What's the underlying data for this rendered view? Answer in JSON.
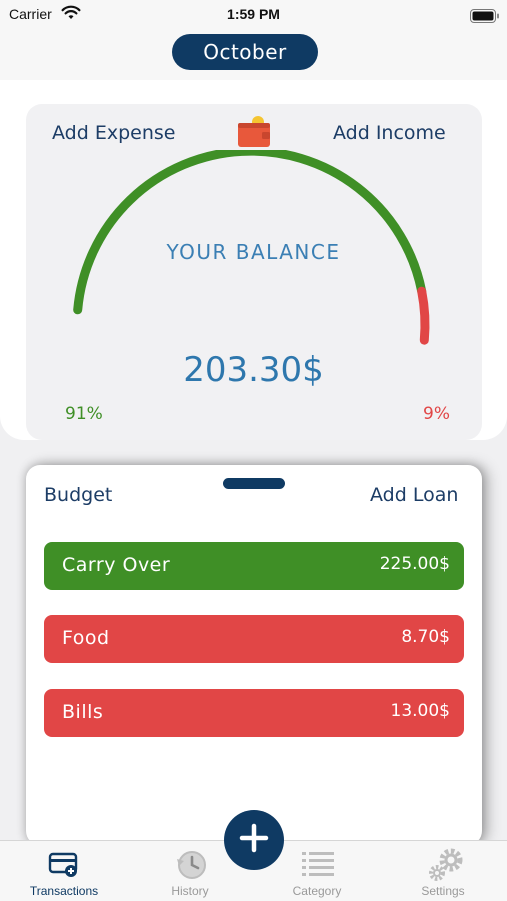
{
  "status_bar": {
    "carrier": "Carrier",
    "time": "1:59 PM"
  },
  "header": {
    "month": "October"
  },
  "balance": {
    "add_expense": "Add Expense",
    "add_income": "Add Income",
    "label": "YOUR BALANCE",
    "amount": "203.30$",
    "income_percent": "91%",
    "expense_percent": "9%",
    "income_fraction": 0.91,
    "expense_fraction": 0.09,
    "income_color": "#3f8f26",
    "expense_color": "#e14646"
  },
  "sheet": {
    "budget": "Budget",
    "add_loan": "Add Loan",
    "rows": [
      {
        "name": "Carry Over",
        "amount": "225.00$",
        "type": "income"
      },
      {
        "name": "Food",
        "amount": "8.70$",
        "type": "expense"
      },
      {
        "name": "Bills",
        "amount": "13.00$",
        "type": "expense"
      }
    ]
  },
  "tabs": [
    {
      "label": "Transactions",
      "active": true,
      "icon": "transactions-icon"
    },
    {
      "label": "History",
      "active": false,
      "icon": "history-icon"
    },
    {
      "label": "Category",
      "active": false,
      "icon": "category-icon"
    },
    {
      "label": "Settings",
      "active": false,
      "icon": "settings-icon"
    }
  ],
  "colors": {
    "primary": "#0f3a63",
    "income": "#3f8f26",
    "expense": "#e14646",
    "accent_text": "#2e77ad"
  }
}
